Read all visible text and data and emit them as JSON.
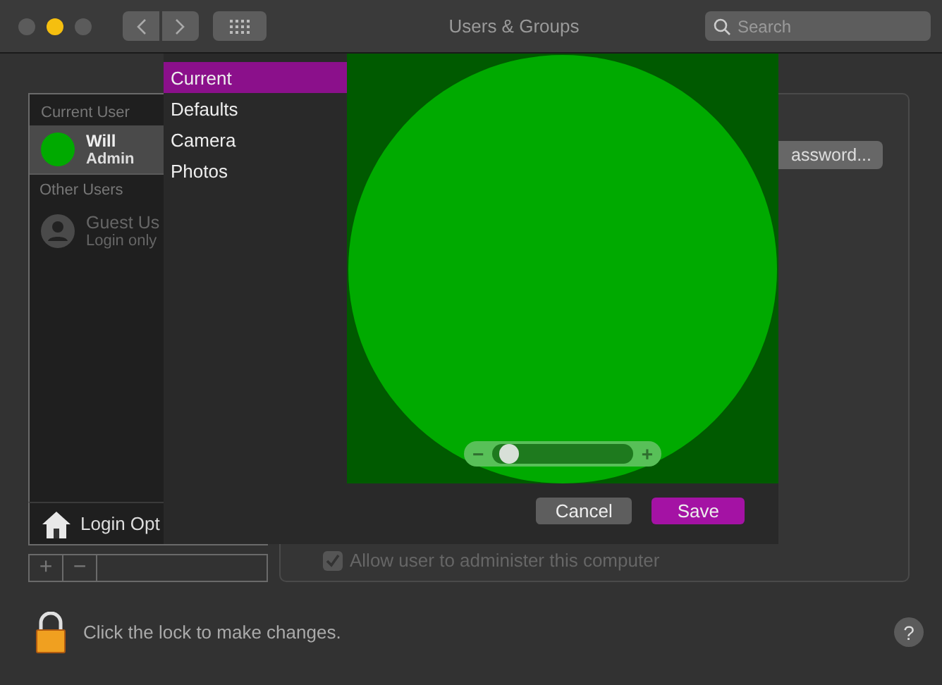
{
  "window": {
    "title": "Users & Groups",
    "traffic_lights": [
      {
        "color": "#5b5b5b"
      },
      {
        "color": "#f5bf0f"
      },
      {
        "color": "#5b5b5b"
      }
    ]
  },
  "search": {
    "placeholder": "Search"
  },
  "sidebar": {
    "sections": [
      {
        "header": "Current User",
        "users": [
          {
            "name": "Will",
            "role": "Admin",
            "selected": true,
            "disabled": false
          }
        ]
      },
      {
        "header": "Other Users",
        "users": [
          {
            "name": "Guest Us",
            "role": "Login only",
            "kind": "generic",
            "selected": false,
            "disabled": true
          }
        ]
      }
    ],
    "login_options": "Login Opt",
    "add_button": "+",
    "remove_button": "−"
  },
  "details": {
    "password_button": "assword...",
    "admin_checkbox": {
      "label": "Allow user to administer this computer",
      "checked": true,
      "disabled": true
    }
  },
  "picture_editor": {
    "menu": [
      {
        "label": "Current",
        "selected": true
      },
      {
        "label": "Defaults",
        "selected": false
      },
      {
        "label": "Camera",
        "selected": false
      },
      {
        "label": "Photos",
        "selected": false
      }
    ],
    "zoom": {
      "level": 0.08,
      "minus": "−",
      "plus": "+"
    },
    "buttons": [
      {
        "label": "Cancel",
        "kind": "default"
      },
      {
        "label": "Save",
        "kind": "primary"
      }
    ]
  },
  "footer": {
    "lock_text": "Click the lock to make changes.",
    "help": "?"
  }
}
